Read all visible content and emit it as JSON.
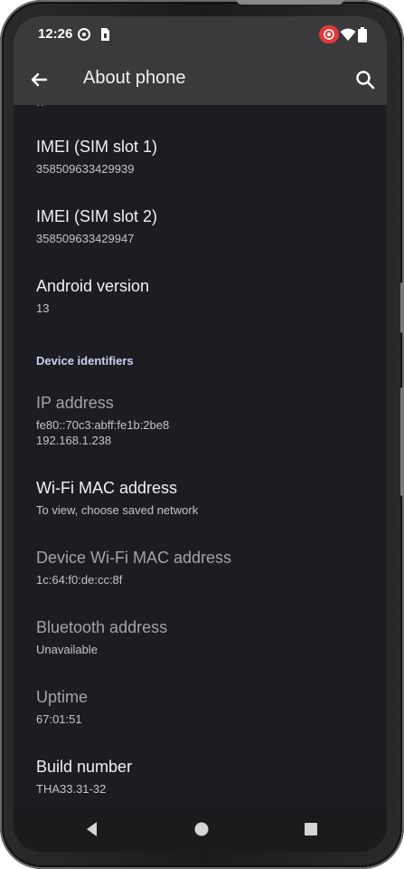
{
  "status_bar": {
    "time": "12:26",
    "icons": [
      "gear-notification-icon",
      "sim-card-icon",
      "screen-record-icon",
      "wifi-icon",
      "battery-icon"
    ]
  },
  "app_bar": {
    "title": "About phone",
    "back_icon": "arrow-back-icon",
    "search_icon": "search-icon"
  },
  "items": [
    {
      "title": "IMEI (SIM slot 1)",
      "value": "358509633429939"
    },
    {
      "title": "IMEI (SIM slot 2)",
      "value": "358509633429947"
    },
    {
      "title": "Android version",
      "value": "13"
    }
  ],
  "section_header": "Device identifiers",
  "identifiers": [
    {
      "title": "IP address",
      "value": "fe80::70c3:abff:fe1b:2be8",
      "value2": "192.168.1.238"
    },
    {
      "title": "Wi-Fi MAC address",
      "value": "To view, choose saved network"
    },
    {
      "title": "Device Wi-Fi MAC address",
      "value": "1c:64:f0:de:cc:8f"
    },
    {
      "title": "Bluetooth address",
      "value": "Unavailable"
    },
    {
      "title": "Uptime",
      "value": "67:01:51"
    },
    {
      "title": "Build number",
      "value": "THA33.31-32"
    }
  ],
  "nav_bar": {
    "icons": [
      "nav-back-icon",
      "nav-home-icon",
      "nav-recents-icon"
    ]
  },
  "colors": {
    "background": "#1d1c21",
    "app_bar": "#3a3a3c",
    "accent_header": "#c9d3f5",
    "record_badge": "#e03a3a"
  }
}
